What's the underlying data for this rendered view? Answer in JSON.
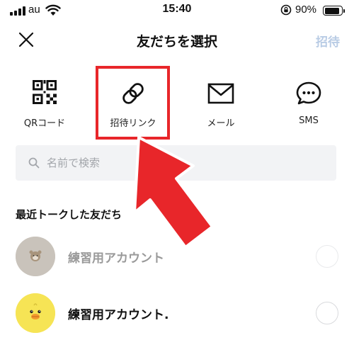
{
  "status_bar": {
    "carrier": "au",
    "time": "15:40",
    "battery": "90%",
    "battery_level": 0.9,
    "icons": [
      "signal-icon",
      "wifi-icon",
      "rotation-lock-icon",
      "battery-icon"
    ]
  },
  "header": {
    "title": "友だちを選択",
    "invite_label": "招待",
    "close_icon": "close-icon",
    "invite_color": "#b9cce5"
  },
  "actions": [
    {
      "label": "QRコード",
      "icon": "qr-code-icon"
    },
    {
      "label": "招待リンク",
      "icon": "link-icon"
    },
    {
      "label": "メール",
      "icon": "mail-icon"
    },
    {
      "label": "SMS",
      "icon": "sms-icon"
    }
  ],
  "search": {
    "placeholder": "名前で検索",
    "value": "",
    "icon": "search-icon"
  },
  "section_title": "最近トークした友だち",
  "friends": [
    {
      "name": "練習用アカウント",
      "selected": false,
      "avatar_icon": "bear-avatar"
    },
    {
      "name": "練習用アカウント.",
      "selected": false,
      "avatar_icon": "chick-avatar"
    }
  ],
  "annotation": {
    "color": "#e8262a",
    "icon": "red-arrow-annotation"
  }
}
